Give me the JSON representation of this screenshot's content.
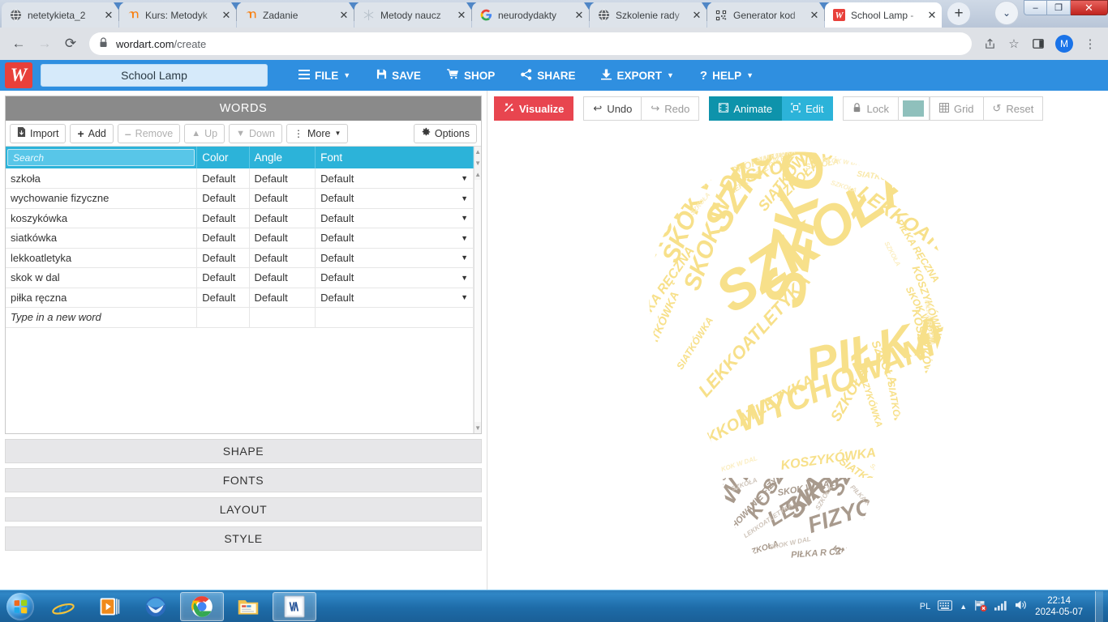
{
  "browser": {
    "tabs": [
      {
        "title": "netetykieta_2",
        "favicon": "globe-icon",
        "active": false
      },
      {
        "title": "Kurs: Metodyk",
        "favicon": "moodle-icon",
        "active": false
      },
      {
        "title": "Zadanie",
        "favicon": "moodle-icon",
        "active": false
      },
      {
        "title": "Metody naucz",
        "favicon": "snowflake-icon",
        "active": false
      },
      {
        "title": "neurodydakty",
        "favicon": "google-icon",
        "active": false
      },
      {
        "title": "Szkolenie rady",
        "favicon": "globe-icon",
        "active": false
      },
      {
        "title": "Generator kod",
        "favicon": "qrcode-icon",
        "active": false
      },
      {
        "title": "School Lamp -",
        "favicon": "wordart-icon",
        "active": true
      }
    ],
    "new_tab_label": "+",
    "close_label": "✕",
    "tab_list_chevron": "⌄",
    "window_controls": {
      "minimize": "–",
      "maximize": "❐",
      "close": "✕"
    },
    "nav": {
      "back": "←",
      "forward": "→",
      "reload": "⟳"
    },
    "url_secure": "wordart.com",
    "url_path": "/create",
    "lock_icon": "🔒",
    "omni_actions": {
      "share": "⤴",
      "bookmark": "☆",
      "sidepanel": "▣",
      "menu": "⋮"
    },
    "avatar_letter": "M"
  },
  "app": {
    "logo_letter": "W",
    "title_value": "School Lamp",
    "menu": [
      {
        "label": "FILE",
        "icon": "hamburger-icon",
        "caret": true
      },
      {
        "label": "SAVE",
        "icon": "floppy-icon",
        "caret": false
      },
      {
        "label": "SHOP",
        "icon": "cart-icon",
        "caret": false
      },
      {
        "label": "SHARE",
        "icon": "share-icon",
        "caret": false
      },
      {
        "label": "EXPORT",
        "icon": "download-icon",
        "caret": true
      },
      {
        "label": "HELP",
        "icon": "question-icon",
        "caret": true
      }
    ]
  },
  "words_panel": {
    "title": "WORDS",
    "toolbar": [
      {
        "label": "Import",
        "icon": "import-icon",
        "enabled": true
      },
      {
        "label": "Add",
        "icon": "plus-icon",
        "enabled": true
      },
      {
        "label": "Remove",
        "icon": "minus-icon",
        "enabled": false
      },
      {
        "label": "Up",
        "icon": "arrow-up-icon",
        "enabled": false
      },
      {
        "label": "Down",
        "icon": "arrow-down-icon",
        "enabled": false
      },
      {
        "label": "More",
        "icon": "dots-vertical-icon",
        "enabled": true,
        "caret": true
      }
    ],
    "options_label": "Options",
    "options_icon": "gear-icon",
    "search_placeholder": "Search",
    "columns": [
      "Color",
      "Angle",
      "Font"
    ],
    "rows": [
      {
        "word": "szkoła",
        "color": "Default",
        "angle": "Default",
        "font": "Default"
      },
      {
        "word": "wychowanie fizyczne",
        "color": "Default",
        "angle": "Default",
        "font": "Default"
      },
      {
        "word": "koszykówka",
        "color": "Default",
        "angle": "Default",
        "font": "Default"
      },
      {
        "word": "siatkówka",
        "color": "Default",
        "angle": "Default",
        "font": "Default"
      },
      {
        "word": "lekkoatletyka",
        "color": "Default",
        "angle": "Default",
        "font": "Default"
      },
      {
        "word": "skok w dal",
        "color": "Default",
        "angle": "Default",
        "font": "Default"
      },
      {
        "word": "piłka ręczna",
        "color": "Default",
        "angle": "Default",
        "font": "Default"
      }
    ],
    "new_word_placeholder": "Type in a new word"
  },
  "accordion": [
    {
      "label": "SHAPE"
    },
    {
      "label": "FONTS"
    },
    {
      "label": "LAYOUT"
    },
    {
      "label": "STYLE"
    }
  ],
  "canvas_toolbar": {
    "visualize": {
      "label": "Visualize",
      "icon": "magic-wand-icon"
    },
    "undo": {
      "label": "Undo",
      "icon": "arrow-left-icon"
    },
    "redo": {
      "label": "Redo",
      "icon": "arrow-right-icon"
    },
    "animate": {
      "label": "Animate",
      "icon": "film-icon"
    },
    "edit": {
      "label": "Edit",
      "icon": "transform-icon"
    },
    "lock": {
      "label": "Lock",
      "icon": "lock-icon"
    },
    "color_swatch": "#8fc0bc",
    "grid": {
      "label": "Grid",
      "icon": "grid-icon"
    },
    "reset": {
      "label": "Reset",
      "icon": "refresh-icon"
    }
  },
  "word_cloud": {
    "shape": "light-bulb",
    "bulb_color": "#f7e08a",
    "base_color": "#a89a8d",
    "words": [
      "SZKOŁA",
      "PIŁKA RĘCZNA",
      "LEKKOATLETYKA",
      "KOSZYKÓWKA",
      "SIATKÓWKA",
      "SKOK W DAL",
      "WYCHOWANIE FIZYCZNE"
    ]
  },
  "taskbar": {
    "start_label": "start-orb",
    "items": [
      {
        "name": "internet-explorer-icon",
        "open": false
      },
      {
        "name": "media-player-icon",
        "open": false
      },
      {
        "name": "thunderbird-icon",
        "open": false
      },
      {
        "name": "google-chrome-icon",
        "open": true
      },
      {
        "name": "file-explorer-icon",
        "open": false
      },
      {
        "name": "word-icon",
        "open": true
      }
    ],
    "tray": {
      "language": "PL",
      "keyboard_icon": "keyboard-icon",
      "show_hidden_icon": "chevron-up-icon",
      "action_center_icon": "flag-icon",
      "network_icon": "signal-icon",
      "volume_icon": "speaker-icon"
    },
    "time": "22:14",
    "date": "2024-05-07"
  }
}
